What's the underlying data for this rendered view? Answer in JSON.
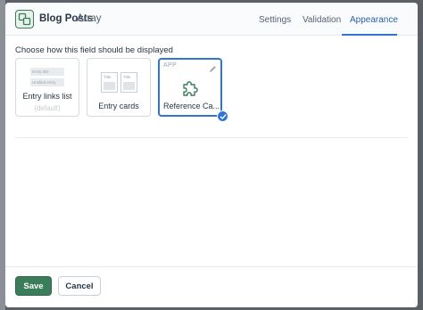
{
  "header": {
    "title": "Blog Posts",
    "subtitle": "Array",
    "type_icon": "reference-icon"
  },
  "tabs": [
    {
      "label": "Settings",
      "active": false
    },
    {
      "label": "Validation",
      "active": false
    },
    {
      "label": "Appearance",
      "active": true
    }
  ],
  "main": {
    "instruction": "Choose how this field should be displayed",
    "options": [
      {
        "label": "Entry links list",
        "sublabel": "(default)",
        "preview_lines": [
          "Entry title",
          "Untitled entry"
        ],
        "selected": false
      },
      {
        "label": "Entry cards",
        "preview_cards": [
          "Title",
          "Title"
        ],
        "selected": false
      },
      {
        "label": "Reference Ca...",
        "badge": "APP",
        "icon": "puzzle-icon",
        "action_icon": "pencil-icon",
        "selected": true
      }
    ]
  },
  "footer": {
    "save_label": "Save",
    "cancel_label": "Cancel"
  },
  "colors": {
    "accent": "#2e75d4",
    "primary_button": "#3b7d5a",
    "text": "#283746"
  }
}
